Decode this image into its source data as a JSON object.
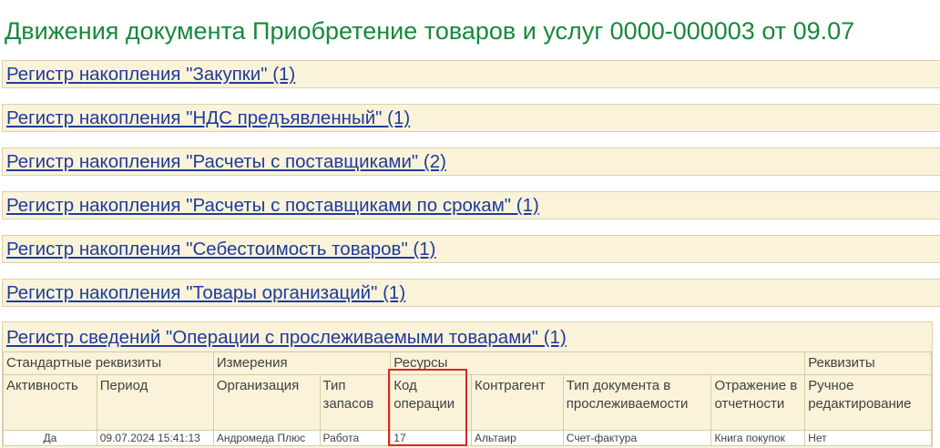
{
  "title": "Движения документа Приобретение товаров и услуг 0000-000003 от 09.07",
  "registers": [
    "Регистр накопления \"Закупки\" (1)",
    "Регистр накопления \"НДС предъявленный\" (1)",
    "Регистр накопления \"Расчеты с поставщиками\" (2)",
    "Регистр накопления \"Расчеты с поставщиками по срокам\" (1)",
    "Регистр накопления \"Себестоимость товаров\" (1)",
    "Регистр накопления \"Товары организаций\" (1)"
  ],
  "info_register": {
    "title": "Регистр сведений \"Операции с прослеживаемыми товарами\" (1)",
    "groups": [
      "Стандартные реквизиты",
      "Измерения",
      "Ресурсы",
      "Реквизиты"
    ],
    "columns": [
      "Активность",
      "Период",
      "Организация",
      "Тип запасов",
      "Код операции",
      "Контрагент",
      "Тип документа в прослеживаемости",
      "Отражение в отчетности",
      "Ручное редактирование"
    ],
    "row": [
      "Да",
      "09.07.2024 15:41:13",
      "Андромеда Плюс",
      "Работа",
      "17",
      "Альтаир",
      "Счет-фактура",
      "Книга покупок",
      "Нет"
    ]
  }
}
